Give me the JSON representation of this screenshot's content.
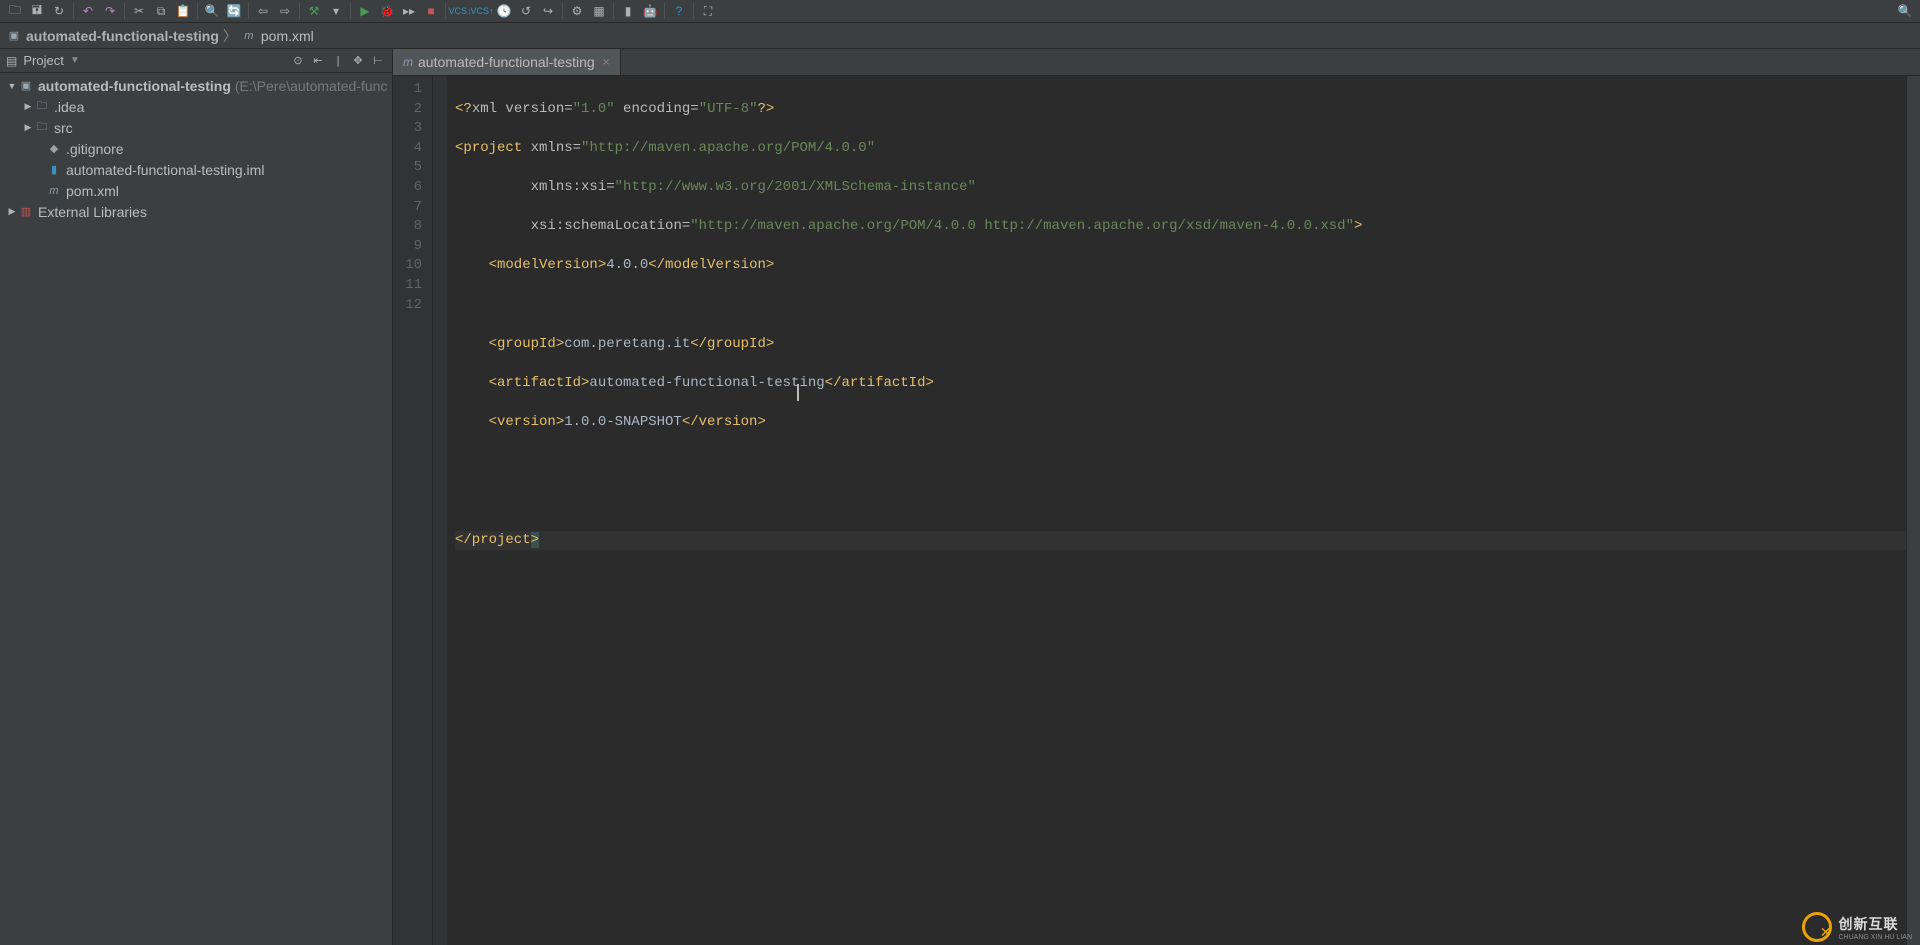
{
  "navbar": {
    "project_name": "automated-functional-testing",
    "file": "pom.xml",
    "file_icon": "m",
    "project_icon": "folder"
  },
  "project_panel": {
    "title": "Project",
    "root": {
      "name": "automated-functional-testing",
      "path": "(E:\\Pere\\automated-func"
    },
    "children": [
      {
        "name": ".idea",
        "icon": "folder",
        "twisty": "▶",
        "indent": 1
      },
      {
        "name": "src",
        "icon": "folder",
        "twisty": "▶",
        "indent": 1
      },
      {
        "name": ".gitignore",
        "icon": "file-git",
        "twisty": "",
        "indent": 1
      },
      {
        "name": "automated-functional-testing.iml",
        "icon": "file-iml",
        "twisty": "",
        "indent": 1
      },
      {
        "name": "pom.xml",
        "icon": "m",
        "twisty": "",
        "indent": 1
      }
    ],
    "external_libs": "External Libraries"
  },
  "editor": {
    "tab_label": "automated-functional-testing",
    "tab_icon": "m",
    "code_lines": {
      "l1_a": "<?",
      "l1_b": "xml version",
      "l1_c": "=",
      "l1_d": "\"1.0\"",
      "l1_e": " encoding",
      "l1_f": "=",
      "l1_g": "\"UTF-8\"",
      "l1_h": "?>",
      "l2_a": "<project ",
      "l2_b": "xmlns",
      "l2_c": "=",
      "l2_d": "\"http://maven.apache.org/POM/4.0.0\"",
      "l3_a": "         ",
      "l3_b": "xmlns:xsi",
      "l3_c": "=",
      "l3_d": "\"http://www.w3.org/2001/XMLSchema-instance\"",
      "l4_a": "         ",
      "l4_b": "xsi",
      "l4_c": ":schemaLocation",
      "l4_d": "=",
      "l4_e": "\"http://maven.apache.org/POM/4.0.0 http://maven.apache.org/xsd/maven-4.0.0.xsd\"",
      "l4_f": ">",
      "l5_a": "    <modelVersion>",
      "l5_b": "4.0.0",
      "l5_c": "</modelVersion>",
      "l7_a": "    <groupId>",
      "l7_b": "com.peretang.it",
      "l7_c": "</groupId>",
      "l8_a": "    <artifactId>",
      "l8_b": "automated-functional-testing",
      "l8_c": "</artifactId>",
      "l9_a": "    <version>",
      "l9_b": "1.0.0-SNAPSHOT",
      "l9_c": "</version>",
      "l12_a": "</project",
      "l12_b": ">"
    },
    "line_numbers": [
      "1",
      "2",
      "3",
      "4",
      "5",
      "6",
      "7",
      "8",
      "9",
      "10",
      "11",
      "12"
    ]
  },
  "watermark": {
    "main": "创新互联",
    "sub": "CHUANG XIN HU LIAN"
  }
}
